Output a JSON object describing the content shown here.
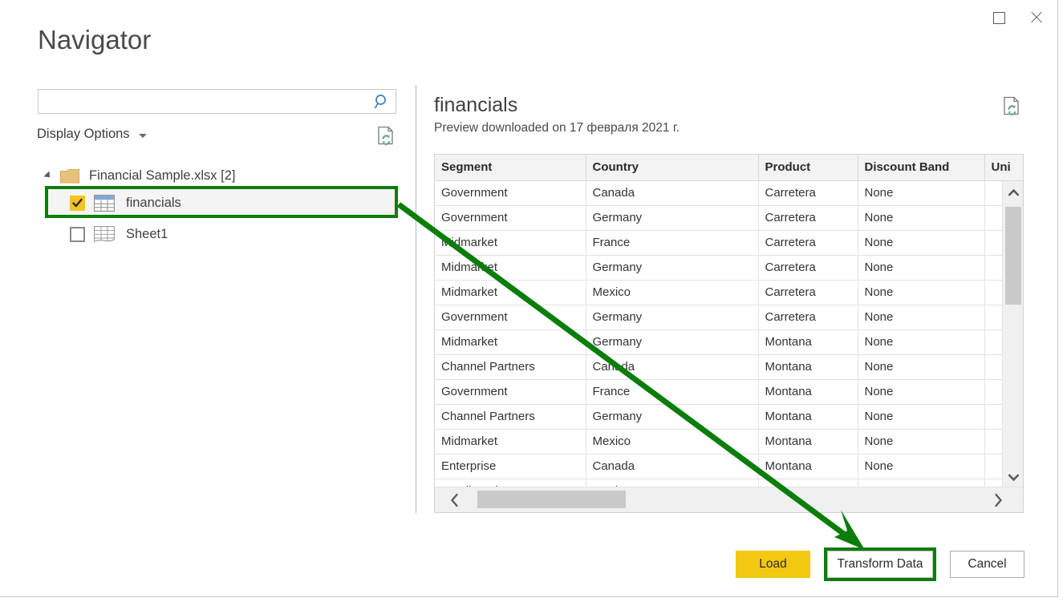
{
  "window": {
    "title": "Navigator",
    "maximize_label": "Maximize",
    "close_label": "Close"
  },
  "search": {
    "value": "",
    "placeholder": "",
    "icon": "search-icon"
  },
  "left_pane": {
    "display_options_label": "Display Options",
    "display_options_caret": "chevron-down-icon",
    "refresh_icon": "refresh-document-icon",
    "tree": {
      "root": {
        "label": "Financial Sample.xlsx [2]",
        "expanded": true,
        "icon": "folder-icon"
      },
      "children": [
        {
          "label": "financials",
          "checked": true,
          "selected": true,
          "icon": "table-icon",
          "highlighted": true
        },
        {
          "label": "Sheet1",
          "checked": false,
          "selected": false,
          "icon": "worksheet-icon",
          "highlighted": false
        }
      ]
    }
  },
  "preview": {
    "title": "financials",
    "subtitle": "Preview downloaded on 17 февраля 2021 г.",
    "refresh_icon": "refresh-document-icon",
    "columns": [
      "Segment",
      "Country",
      "Product",
      "Discount Band",
      "Uni"
    ],
    "rows": [
      [
        "Government",
        "Canada",
        "Carretera",
        "None",
        ""
      ],
      [
        "Government",
        "Germany",
        "Carretera",
        "None",
        ""
      ],
      [
        "Midmarket",
        "France",
        "Carretera",
        "None",
        ""
      ],
      [
        "Midmarket",
        "Germany",
        "Carretera",
        "None",
        ""
      ],
      [
        "Midmarket",
        "Mexico",
        "Carretera",
        "None",
        ""
      ],
      [
        "Government",
        "Germany",
        "Carretera",
        "None",
        ""
      ],
      [
        "Midmarket",
        "Germany",
        "Montana",
        "None",
        ""
      ],
      [
        "Channel Partners",
        "Canada",
        "Montana",
        "None",
        ""
      ],
      [
        "Government",
        "France",
        "Montana",
        "None",
        ""
      ],
      [
        "Channel Partners",
        "Germany",
        "Montana",
        "None",
        ""
      ],
      [
        "Midmarket",
        "Mexico",
        "Montana",
        "None",
        ""
      ],
      [
        "Enterprise",
        "Canada",
        "Montana",
        "None",
        ""
      ],
      [
        "Small Busi",
        "Mexi",
        "Monta",
        "No",
        ""
      ]
    ],
    "vscroll": {
      "up_icon": "chevron-up-icon",
      "down_icon": "chevron-down-icon"
    },
    "hscroll": {
      "left_icon": "chevron-left-icon",
      "right_icon": "chevron-right-icon"
    }
  },
  "footer": {
    "load_label": "Load",
    "transform_label": "Transform Data",
    "cancel_label": "Cancel"
  },
  "annotation": {
    "color": "#0a7d0a",
    "arrow_from": "financials-tree-row",
    "arrow_to": "transform-data-button"
  },
  "colors": {
    "load_button": "#f2c811",
    "annotation_green": "#0a7d0a",
    "checkbox_checked": "#f5c220",
    "search_icon": "#3d7fb5"
  }
}
